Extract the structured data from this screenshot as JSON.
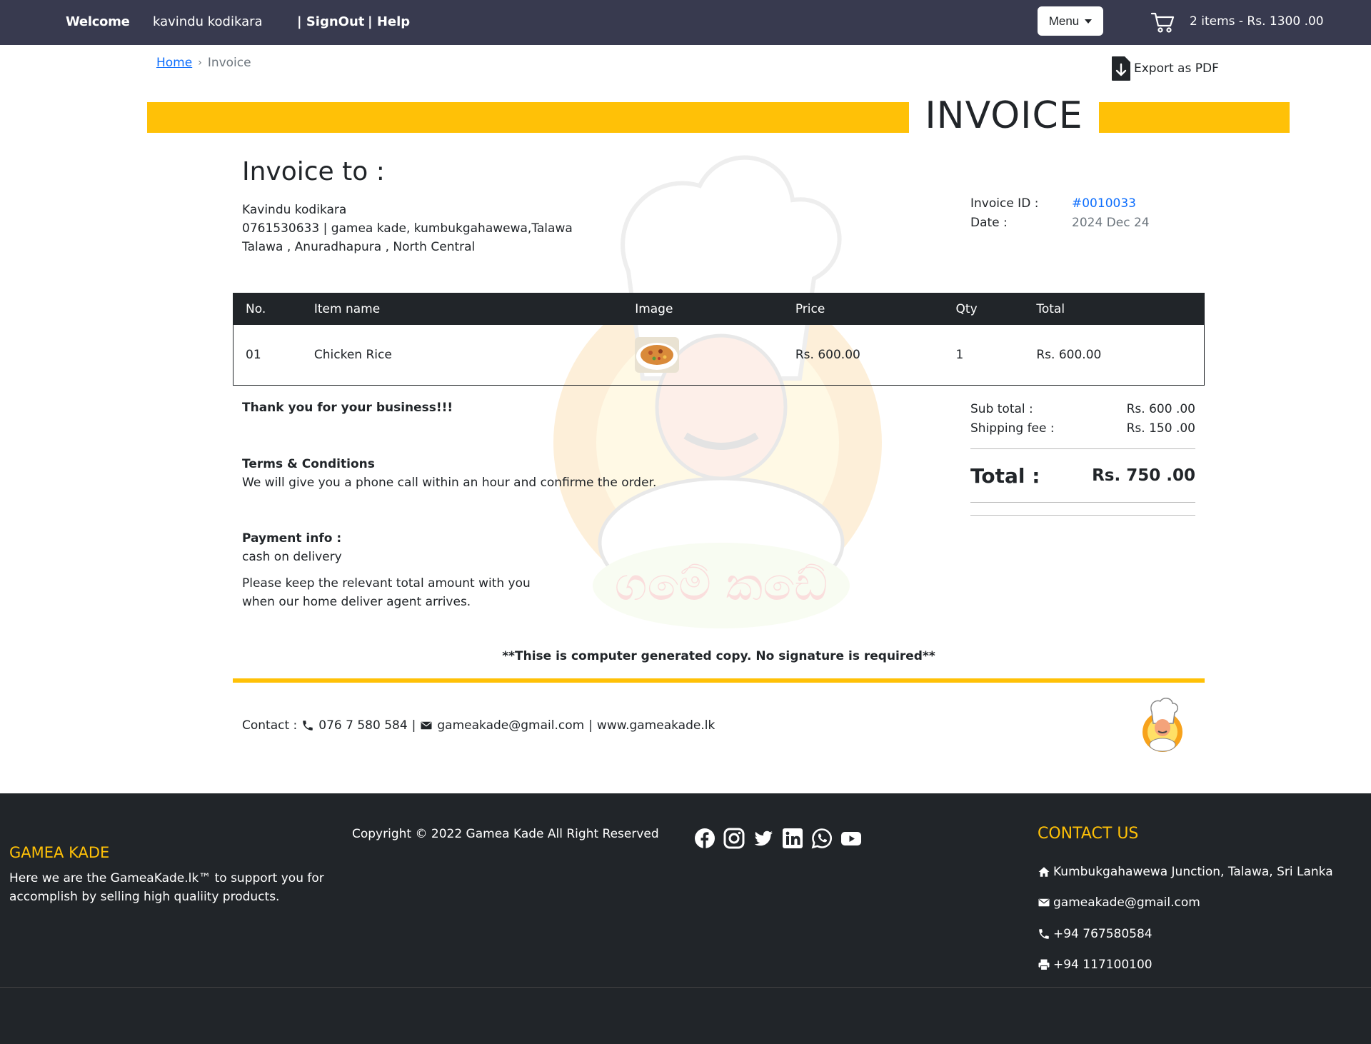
{
  "nav": {
    "welcome": "Welcome",
    "username": "kavindu kodikara",
    "signout": "| SignOut",
    "help": "| Help",
    "menu": "Menu",
    "cart_summary": "2 items - Rs. 1300 .00"
  },
  "breadcrumb": {
    "home": "Home",
    "current": "Invoice"
  },
  "export_label": "Export as PDF",
  "invoice_title": "INVOICE",
  "bill_to": {
    "title": "Invoice to :",
    "name": "Kavindu kodikara",
    "address1": "0761530633 | gamea kade, kumbukgahawewa,Talawa",
    "address2": "Talawa , Anuradhapura , North Central"
  },
  "meta": {
    "id_label": "Invoice ID :",
    "id_value": "#0010033",
    "date_label": "Date :",
    "date_value": "2024 Dec 24"
  },
  "table": {
    "headers": [
      "No.",
      "Item name",
      "Image",
      "Price",
      "Qty",
      "Total"
    ],
    "rows": [
      {
        "no": "01",
        "name": "Chicken Rice",
        "price": "Rs. 600.00",
        "qty": "1",
        "total": "Rs. 600.00"
      }
    ]
  },
  "notes": {
    "thanks": "Thank you for your business!!!",
    "terms_title": "Terms & Conditions",
    "terms_text": "We will give you a phone call within an hour and confirme the order.",
    "payment_title": "Payment info :",
    "payment_method": "cash on delivery",
    "payment_note1": "Please keep the relevant total amount with you",
    "payment_note2": "when our home deliver agent arrives."
  },
  "totals": {
    "subtotal_label": "Sub total :",
    "subtotal_value": "Rs. 600 .00",
    "shipping_label": "Shipping fee :",
    "shipping_value": "Rs. 150 .00",
    "total_label": "Total :",
    "total_value": "Rs. 750 .00"
  },
  "generated_note": "**Thise is computer generated copy. No signature is required**",
  "contact_line": {
    "label": "Contact :",
    "phone": "076 7 580 584",
    "sep": "|",
    "email": "gameakade@gmail.com",
    "website": "www.gameakade.lk"
  },
  "footer": {
    "brand": "GAMEA KADE",
    "about": "Here we are the GameaKade.lk™ to support you for accomplish by selling high qualiity products.",
    "copyright": "Copyright © 2022 Gamea Kade All Right Reserved",
    "contact_title": "CONTACT US",
    "address": "Kumbukgahawewa Junction, Talawa, Sri Lanka",
    "email": "gameakade@gmail.com",
    "phone": "+94 767580584",
    "fax": "+94 117100100"
  },
  "colors": {
    "accent": "#ffc107",
    "nav_bg": "#383a4f",
    "footer_bg": "#212529",
    "link": "#0d6efd"
  }
}
